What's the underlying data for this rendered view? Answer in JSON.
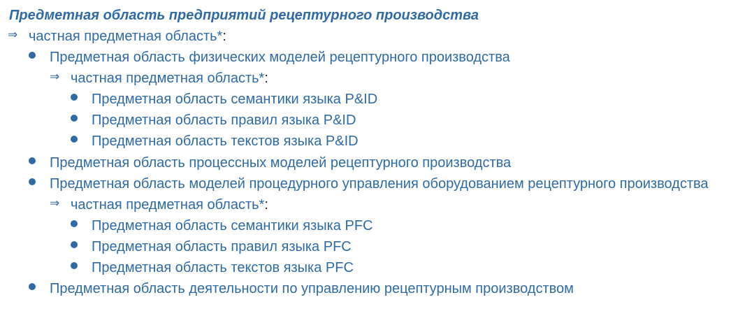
{
  "title": "Предметная область предприятий рецептурного производства",
  "relation_label": "частная предметная область*",
  "relation_colon": ":",
  "arrow_glyph": "⇒",
  "items": [
    "Предметная область физических моделей рецептурного производства",
    "Предметная область семантики языка P&ID",
    "Предметная область правил языка P&ID",
    "Предметная область текстов языка P&ID",
    "Предметная область процессных моделей рецептурного производства",
    "Предметная область моделей процедурного управления оборудованием рецептурного производства",
    "Предметная область семантики языка PFC",
    "Предметная область правил языка PFC",
    "Предметная область текстов языка PFC",
    "Предметная область деятельности по управлению рецептурным производством"
  ],
  "colors": {
    "link": "#2e6aa6",
    "text": "#222222"
  }
}
